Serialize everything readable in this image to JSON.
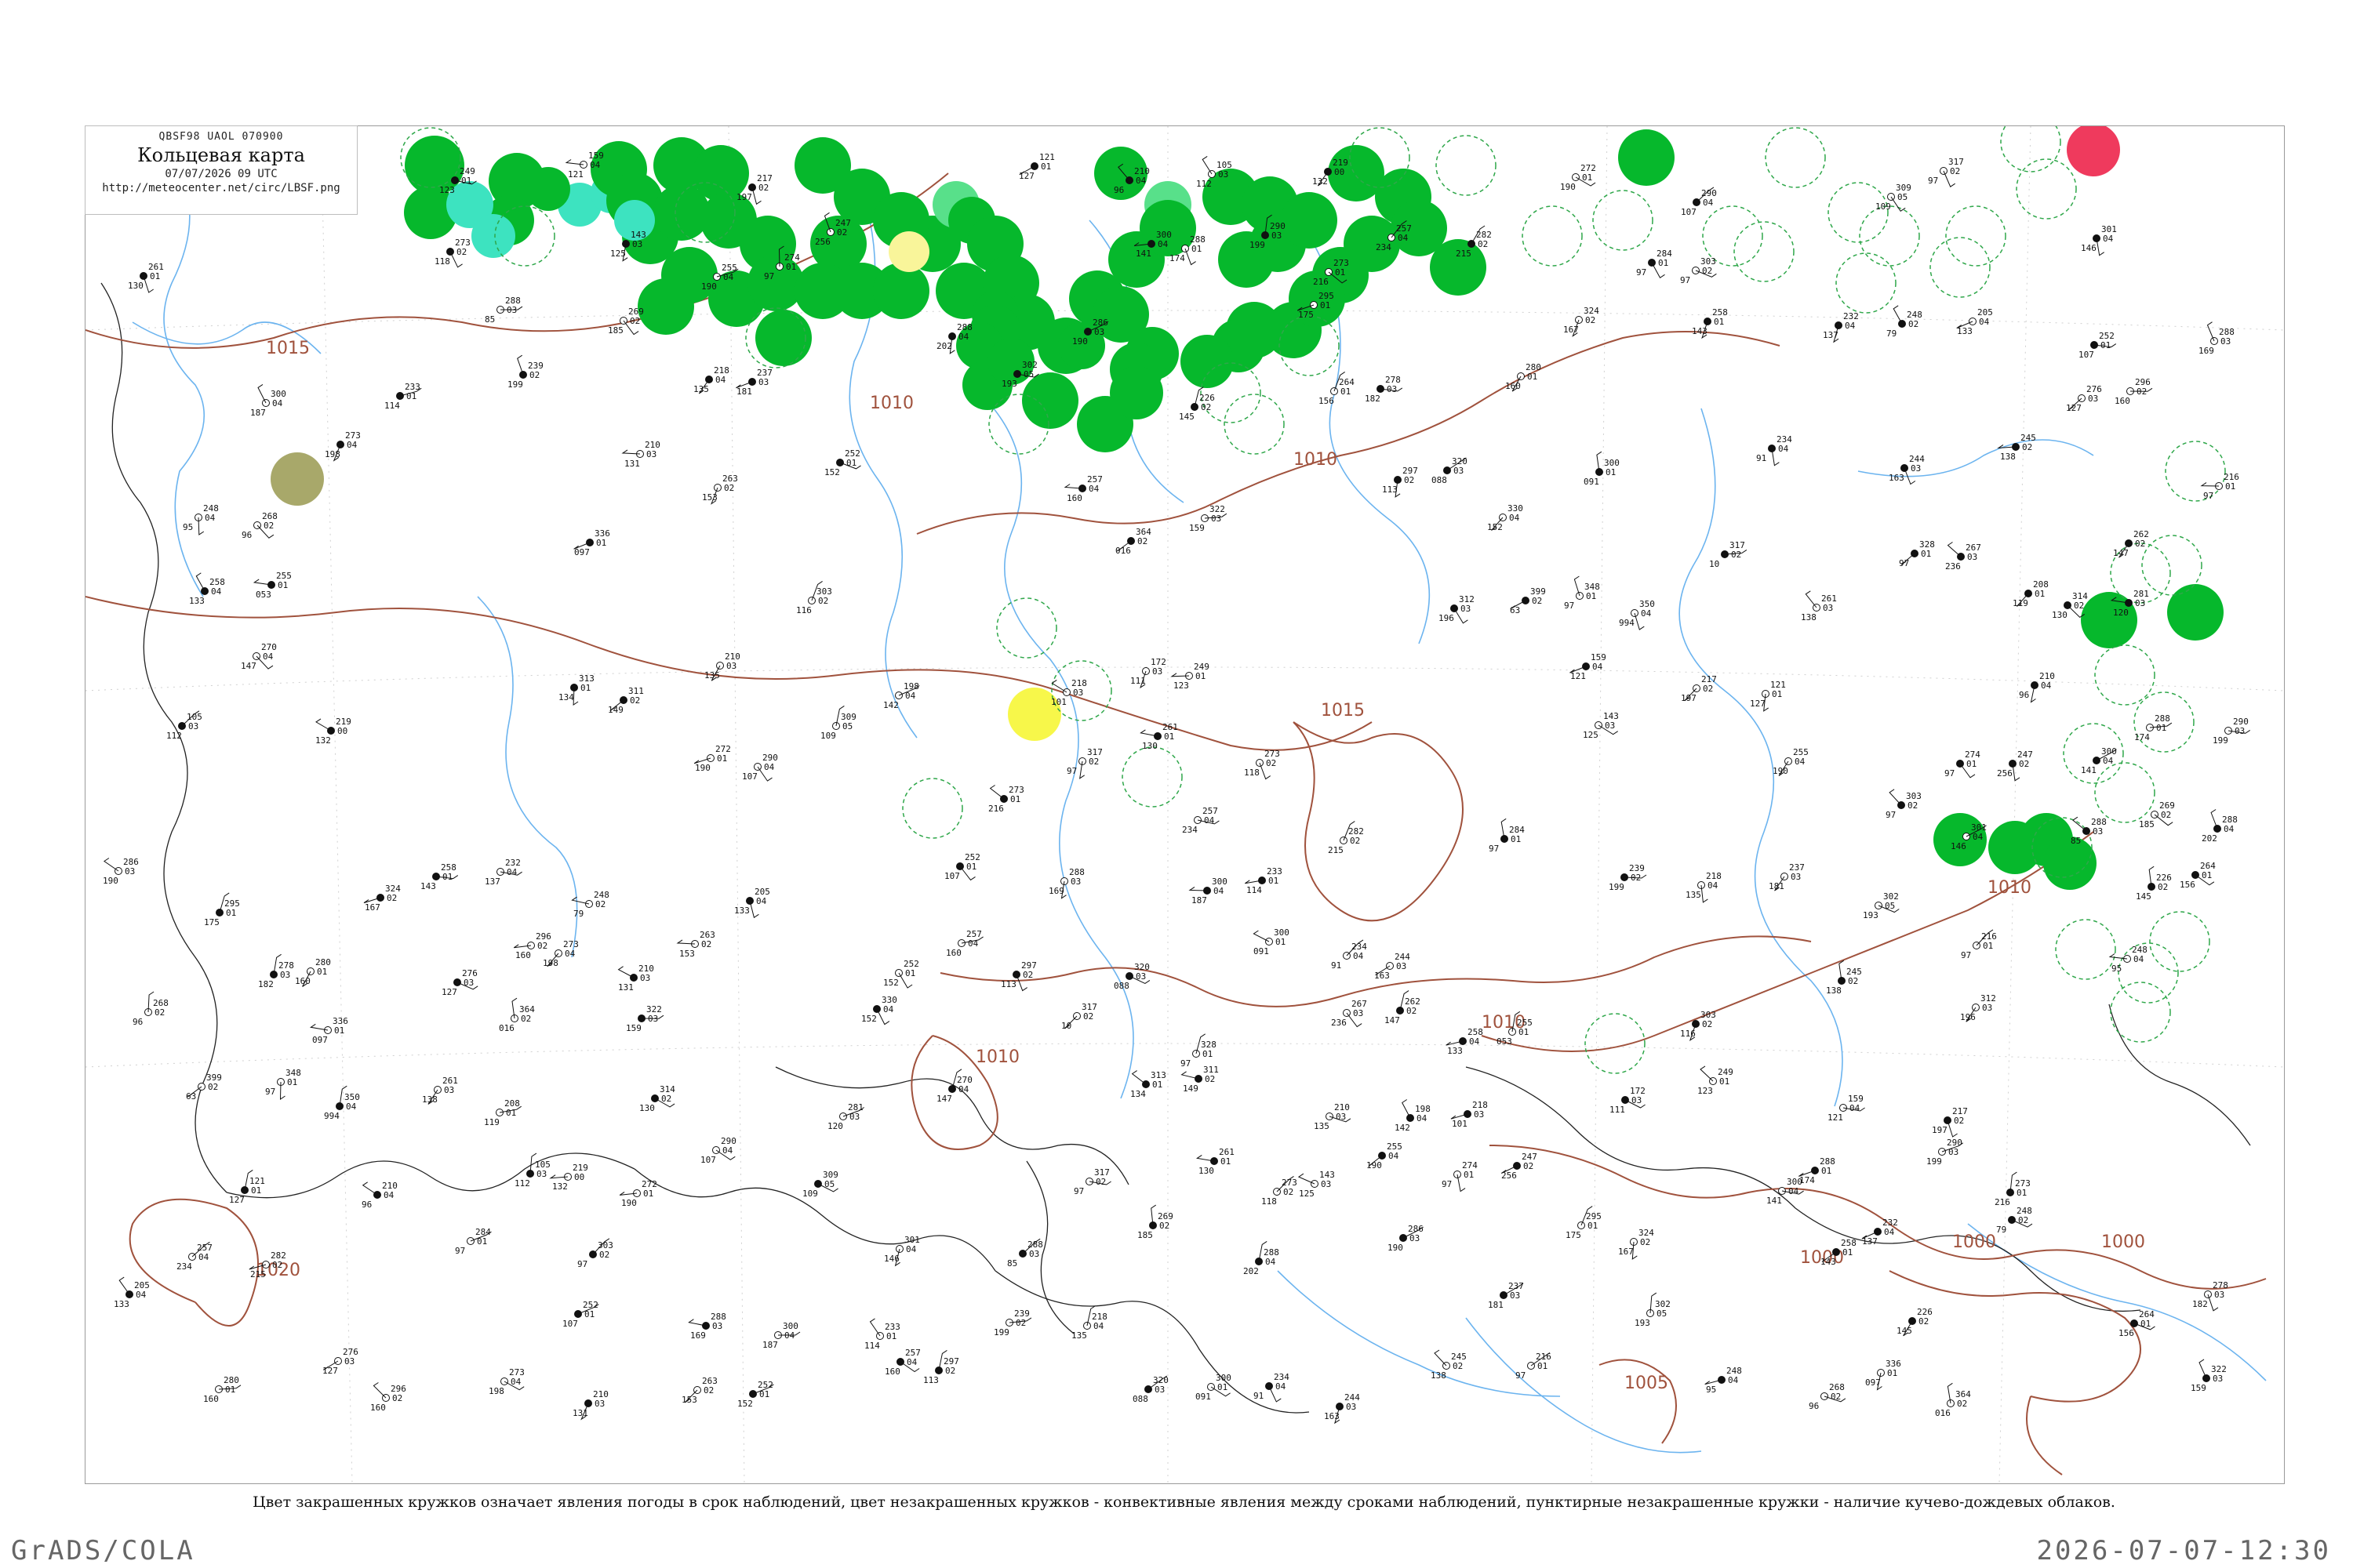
{
  "header": {
    "code": "QBSF98  UAOL  070900",
    "title": "Кольцевая карта",
    "time": "07/07/2026 09 UTC",
    "url": "http://meteocenter.net/circ/LBSF.png"
  },
  "caption": "Цвет закрашенных кружков означает явления погоды в срок наблюдений, цвет незакрашенных кружков - конвективные явления между сроками наблюдений, пунктирные незакрашенные кружки - наличие кучево-дождевых облаков.",
  "footer": {
    "left": "GrADS/COLA",
    "right": "2026-07-07-12:30"
  },
  "colors": {
    "rain": "#06b82c",
    "shower_light": "#58e08a",
    "drizzle": "#3de3c0",
    "fog": "#f7f74a",
    "haze": "#f9f59a",
    "thunder": "#ef3a5d",
    "smoke": "#a8a86a",
    "isobar": "#a0523d",
    "river": "#6cb4ef",
    "border": "#111111",
    "cb_ring": "#2fa74a"
  },
  "isobars": [
    "1020",
    "1015",
    "1015",
    "1010",
    "1010",
    "1010",
    "1010",
    "1010",
    "1005",
    "1000",
    "1000",
    "1000"
  ],
  "stations": [
    {
      "p": "172",
      "t": "03",
      "tt": "111"
    },
    {
      "p": "249",
      "t": "01",
      "tt": "123"
    },
    {
      "p": "159",
      "t": "04",
      "tt": "121"
    },
    {
      "p": "217",
      "t": "02",
      "tt": "197"
    },
    {
      "p": "121",
      "t": "01",
      "tt": "127"
    },
    {
      "p": "210",
      "t": "04",
      "tt": "96"
    },
    {
      "p": "105",
      "t": "03",
      "tt": "112"
    },
    {
      "p": "219",
      "t": "00",
      "tt": "132"
    },
    {
      "p": "272",
      "t": "01",
      "tt": "190"
    },
    {
      "p": "290",
      "t": "04",
      "tt": "107"
    },
    {
      "p": "309",
      "t": "05",
      "tt": "109"
    },
    {
      "p": "317",
      "t": "02",
      "tt": "97"
    },
    {
      "p": "261",
      "t": "01",
      "tt": "130"
    },
    {
      "p": "273",
      "t": "02",
      "tt": "118"
    },
    {
      "p": "143",
      "t": "03",
      "tt": "125"
    },
    {
      "p": "255",
      "t": "04",
      "tt": "190"
    },
    {
      "p": "274",
      "t": "01",
      "tt": "97"
    },
    {
      "p": "247",
      "t": "02",
      "tt": "256"
    },
    {
      "p": "300",
      "t": "04",
      "tt": "141"
    },
    {
      "p": "288",
      "t": "01",
      "tt": "174"
    },
    {
      "p": "290",
      "t": "03",
      "tt": "199"
    },
    {
      "p": "273",
      "t": "01",
      "tt": "216"
    },
    {
      "p": "257",
      "t": "04",
      "tt": "234"
    },
    {
      "p": "282",
      "t": "02",
      "tt": "215"
    },
    {
      "p": "284",
      "t": "01",
      "tt": "97"
    },
    {
      "p": "303",
      "t": "02",
      "tt": "97"
    },
    {
      "p": "301",
      "t": "04",
      "tt": "146"
    },
    {
      "p": "288",
      "t": "03",
      "tt": "85"
    },
    {
      "p": "269",
      "t": "02",
      "tt": "185"
    },
    {
      "p": "288",
      "t": "04",
      "tt": "202"
    },
    {
      "p": "286",
      "t": "03",
      "tt": "190"
    },
    {
      "p": "295",
      "t": "01",
      "tt": "175"
    },
    {
      "p": "324",
      "t": "02",
      "tt": "167"
    },
    {
      "p": "258",
      "t": "01",
      "tt": "143"
    },
    {
      "p": "232",
      "t": "04",
      "tt": "137"
    },
    {
      "p": "248",
      "t": "02",
      "tt": "79"
    },
    {
      "p": "205",
      "t": "04",
      "tt": "133"
    },
    {
      "p": "252",
      "t": "01",
      "tt": "107"
    },
    {
      "p": "288",
      "t": "03",
      "tt": "169"
    },
    {
      "p": "300",
      "t": "04",
      "tt": "187"
    },
    {
      "p": "233",
      "t": "01",
      "tt": "114"
    },
    {
      "p": "239",
      "t": "02",
      "tt": "199"
    },
    {
      "p": "218",
      "t": "04",
      "tt": "135"
    },
    {
      "p": "237",
      "t": "03",
      "tt": "181"
    },
    {
      "p": "302",
      "t": "05",
      "tt": "193"
    },
    {
      "p": "226",
      "t": "02",
      "tt": "145"
    },
    {
      "p": "264",
      "t": "01",
      "tt": "156"
    },
    {
      "p": "278",
      "t": "03",
      "tt": "182"
    },
    {
      "p": "280",
      "t": "01",
      "tt": "160"
    },
    {
      "p": "276",
      "t": "03",
      "tt": "127"
    },
    {
      "p": "296",
      "t": "02",
      "tt": "160"
    },
    {
      "p": "273",
      "t": "04",
      "tt": "198"
    },
    {
      "p": "210",
      "t": "03",
      "tt": "131"
    },
    {
      "p": "263",
      "t": "02",
      "tt": "153"
    },
    {
      "p": "252",
      "t": "01",
      "tt": "152"
    },
    {
      "p": "257",
      "t": "04",
      "tt": "160"
    },
    {
      "p": "297",
      "t": "02",
      "tt": "113"
    },
    {
      "p": "320",
      "t": "03",
      "tt": "088"
    },
    {
      "p": "300",
      "t": "01",
      "tt": "091"
    },
    {
      "p": "234",
      "t": "04",
      "tt": "91"
    },
    {
      "p": "244",
      "t": "03",
      "tt": "163"
    },
    {
      "p": "245",
      "t": "02",
      "tt": "138"
    },
    {
      "p": "216",
      "t": "01",
      "tt": "97"
    },
    {
      "p": "248",
      "t": "04",
      "tt": "95"
    },
    {
      "p": "268",
      "t": "02",
      "tt": "96"
    },
    {
      "p": "336",
      "t": "01",
      "tt": "097"
    },
    {
      "p": "364",
      "t": "02",
      "tt": "016"
    },
    {
      "p": "322",
      "t": "03",
      "tt": "159"
    },
    {
      "p": "330",
      "t": "04",
      "tt": "152"
    },
    {
      "p": "317",
      "t": "02",
      "tt": "10"
    },
    {
      "p": "328",
      "t": "01",
      "tt": "97"
    },
    {
      "p": "267",
      "t": "03",
      "tt": "236"
    },
    {
      "p": "262",
      "t": "02",
      "tt": "147"
    },
    {
      "p": "258",
      "t": "04",
      "tt": "133"
    },
    {
      "p": "255",
      "t": "01",
      "tt": "053"
    },
    {
      "p": "303",
      "t": "02",
      "tt": "116"
    },
    {
      "p": "312",
      "t": "03",
      "tt": "196"
    },
    {
      "p": "399",
      "t": "02",
      "tt": "63"
    },
    {
      "p": "348",
      "t": "01",
      "tt": "97"
    },
    {
      "p": "350",
      "t": "04",
      "tt": "994"
    },
    {
      "p": "261",
      "t": "03",
      "tt": "138"
    },
    {
      "p": "208",
      "t": "01",
      "tt": "119"
    },
    {
      "p": "314",
      "t": "02",
      "tt": "130"
    },
    {
      "p": "281",
      "t": "03",
      "tt": "120"
    },
    {
      "p": "270",
      "t": "04",
      "tt": "147"
    },
    {
      "p": "313",
      "t": "01",
      "tt": "134"
    },
    {
      "p": "311",
      "t": "02",
      "tt": "149"
    },
    {
      "p": "210",
      "t": "03",
      "tt": "135"
    },
    {
      "p": "198",
      "t": "04",
      "tt": "142"
    },
    {
      "p": "218",
      "t": "03",
      "tt": "101"
    }
  ]
}
